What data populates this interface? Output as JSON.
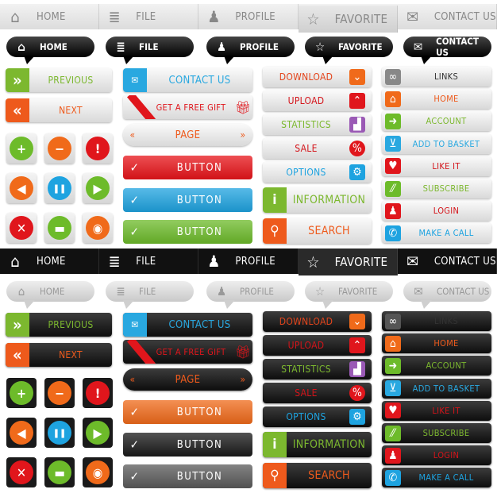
{
  "sections": [
    {
      "theme": "light",
      "nav": [
        {
          "label": "HOME",
          "icon": "home-icon",
          "glyph": "⌂"
        },
        {
          "label": "FILE",
          "icon": "file-icon",
          "glyph": "≣"
        },
        {
          "label": "PROFILE",
          "icon": "user-icon",
          "glyph": "♟"
        },
        {
          "label": "FAVORITE",
          "icon": "star-icon",
          "glyph": "☆",
          "active": true
        },
        {
          "label": "CONTACT US",
          "icon": "mail-icon",
          "glyph": "✉"
        }
      ],
      "bubbles": [
        {
          "label": "HOME",
          "icon": "home-icon",
          "glyph": "⌂"
        },
        {
          "label": "FILE",
          "icon": "file-icon",
          "glyph": "≣"
        },
        {
          "label": "PROFILE",
          "icon": "user-icon",
          "glyph": "♟"
        },
        {
          "label": "FAVORITE",
          "icon": "star-icon",
          "glyph": "☆"
        },
        {
          "label": "CONTACT US",
          "icon": "mail-icon",
          "glyph": "✉"
        }
      ],
      "previous": {
        "label": "PREVIOUS",
        "color": "#7cb82f",
        "glyph": "»"
      },
      "next": {
        "label": "NEXT",
        "color": "#ee5a1c",
        "glyph": "«"
      },
      "icon_grid": [
        {
          "icon": "plus-icon",
          "glyph": "+",
          "color": "#6dbb2a"
        },
        {
          "icon": "minus-icon",
          "glyph": "−",
          "color": "#f06a1a"
        },
        {
          "icon": "alert-icon",
          "glyph": "!",
          "color": "#e0161c"
        },
        {
          "icon": "back-icon",
          "glyph": "◀",
          "color": "#f06a1a"
        },
        {
          "icon": "pause-icon",
          "glyph": "❚❚",
          "color": "#1ea3e0"
        },
        {
          "icon": "play-icon",
          "glyph": "▶",
          "color": "#6dbb2a"
        },
        {
          "icon": "close-icon",
          "glyph": "✕",
          "color": "#e0161c"
        },
        {
          "icon": "chat-icon",
          "glyph": "▬",
          "color": "#6dbb2a"
        },
        {
          "icon": "rss-icon",
          "glyph": "◉",
          "color": "#f06a1a"
        }
      ],
      "contact": {
        "label": "CONTACT US",
        "color": "#29a8e0"
      },
      "gift": {
        "label": "GET A FREE GIFT",
        "color": "#e0161c"
      },
      "page": {
        "label": "PAGE",
        "color": "#ee5a1c"
      },
      "buttons": [
        {
          "label": "BUTTON",
          "color": "#e8141a"
        },
        {
          "label": "BUTTON",
          "color": "#1ea3e0"
        },
        {
          "label": "BUTTON",
          "color": "#6dbb2a"
        }
      ],
      "col3": [
        {
          "label": "DOWNLOAD",
          "color": "#e4451c",
          "icon": "download-icon",
          "glyph": "⌄",
          "icolor": "#f06a1a"
        },
        {
          "label": "UPLOAD",
          "color": "#d4141a",
          "icon": "upload-icon",
          "glyph": "⌃",
          "icolor": "#e0161c"
        },
        {
          "label": "STATISTICS",
          "color": "#7cb82f",
          "icon": "chart-icon",
          "glyph": "▟",
          "icolor": "#9a59b5"
        },
        {
          "label": "SALE",
          "color": "#d4141a",
          "icon": "percent-icon",
          "glyph": "%",
          "icolor": "#e0161c"
        },
        {
          "label": "OPTIONS",
          "color": "#1ea3e0",
          "icon": "gear-icon",
          "glyph": "⚙",
          "icolor": "#1ea3e0"
        }
      ],
      "information": {
        "label": "INFORMATION",
        "color": "#7cb82f",
        "glyph": "i"
      },
      "search": {
        "label": "SEARCH",
        "color": "#ee5a1c",
        "glyph": "⚲"
      },
      "col4": [
        {
          "label": "LINKS",
          "color": "#333333",
          "icon": "link-icon",
          "glyph": "∞",
          "icolor": "#888888"
        },
        {
          "label": "HOME",
          "color": "#ee5a1c",
          "icon": "home-icon",
          "glyph": "⌂",
          "icolor": "#f06a1a"
        },
        {
          "label": "ACCOUNT",
          "color": "#7cb82f",
          "icon": "arrow-right-icon",
          "glyph": "➜",
          "icolor": "#6dbb2a"
        },
        {
          "label": "ADD TO BASKET",
          "color": "#29a8e0",
          "icon": "cart-icon",
          "glyph": "⊻",
          "icolor": "#29a8e0"
        },
        {
          "label": "LIKE IT",
          "color": "#d4141a",
          "icon": "heart-icon",
          "glyph": "♥",
          "icolor": "#e0161c"
        },
        {
          "label": "SUBSCRIBE",
          "color": "#7cb82f",
          "icon": "stripes-icon",
          "glyph": "⁄⁄",
          "icolor": "#6dbb2a"
        },
        {
          "label": "LOGIN",
          "color": "#d4141a",
          "icon": "user-icon",
          "glyph": "♟",
          "icolor": "#e0161c"
        },
        {
          "label": "MAKE A CALL",
          "color": "#1ea3e0",
          "icon": "phone-icon",
          "glyph": "✆",
          "icolor": "#1ea3e0"
        }
      ]
    },
    {
      "theme": "dark",
      "nav": [
        {
          "label": "HOME",
          "icon": "home-icon",
          "glyph": "⌂"
        },
        {
          "label": "FILE",
          "icon": "file-icon",
          "glyph": "≣"
        },
        {
          "label": "PROFILE",
          "icon": "user-icon",
          "glyph": "♟"
        },
        {
          "label": "FAVORITE",
          "icon": "star-icon",
          "glyph": "☆",
          "active": true
        },
        {
          "label": "CONTACT US",
          "icon": "mail-icon",
          "glyph": "✉"
        }
      ],
      "bubbles": [
        {
          "label": "HOME",
          "icon": "home-icon",
          "glyph": "⌂"
        },
        {
          "label": "FILE",
          "icon": "file-icon",
          "glyph": "≣"
        },
        {
          "label": "PROFILE",
          "icon": "user-icon",
          "glyph": "♟"
        },
        {
          "label": "FAVORITE",
          "icon": "star-icon",
          "glyph": "☆"
        },
        {
          "label": "CONTACT US",
          "icon": "mail-icon",
          "glyph": "✉"
        }
      ],
      "previous": {
        "label": "PREVIOUS",
        "color": "#7cb82f",
        "glyph": "»"
      },
      "next": {
        "label": "NEXT",
        "color": "#ee5a1c",
        "glyph": "«"
      },
      "icon_grid": [
        {
          "icon": "plus-icon",
          "glyph": "+",
          "color": "#6dbb2a"
        },
        {
          "icon": "minus-icon",
          "glyph": "−",
          "color": "#f06a1a"
        },
        {
          "icon": "alert-icon",
          "glyph": "!",
          "color": "#e0161c"
        },
        {
          "icon": "back-icon",
          "glyph": "◀",
          "color": "#f06a1a"
        },
        {
          "icon": "pause-icon",
          "glyph": "❚❚",
          "color": "#1ea3e0"
        },
        {
          "icon": "play-icon",
          "glyph": "▶",
          "color": "#6dbb2a"
        },
        {
          "icon": "close-icon",
          "glyph": "✕",
          "color": "#e0161c"
        },
        {
          "icon": "chat-icon",
          "glyph": "▬",
          "color": "#6dbb2a"
        },
        {
          "icon": "rss-icon",
          "glyph": "◉",
          "color": "#f06a1a"
        }
      ],
      "contact": {
        "label": "CONTACT US",
        "color": "#29a8e0"
      },
      "gift": {
        "label": "GET A FREE GIFT",
        "color": "#e0161c"
      },
      "page": {
        "label": "PAGE",
        "color": "#ee5a1c"
      },
      "buttons": [
        {
          "label": "BUTTON",
          "color": "#f06a1a"
        },
        {
          "label": "BUTTON",
          "color": "#1a1a1a"
        },
        {
          "label": "BUTTON",
          "color": "#5a5a5a"
        }
      ],
      "col3": [
        {
          "label": "DOWNLOAD",
          "color": "#e4451c",
          "icon": "download-icon",
          "glyph": "⌄",
          "icolor": "#f06a1a"
        },
        {
          "label": "UPLOAD",
          "color": "#d4141a",
          "icon": "upload-icon",
          "glyph": "⌃",
          "icolor": "#e0161c"
        },
        {
          "label": "STATISTICS",
          "color": "#7cb82f",
          "icon": "chart-icon",
          "glyph": "▟",
          "icolor": "#9a59b5"
        },
        {
          "label": "SALE",
          "color": "#d4141a",
          "icon": "percent-icon",
          "glyph": "%",
          "icolor": "#e0161c"
        },
        {
          "label": "OPTIONS",
          "color": "#1ea3e0",
          "icon": "gear-icon",
          "glyph": "⚙",
          "icolor": "#1ea3e0"
        }
      ],
      "information": {
        "label": "INFORMATION",
        "color": "#7cb82f",
        "glyph": "i"
      },
      "search": {
        "label": "SEARCH",
        "color": "#ee5a1c",
        "glyph": "⚲"
      },
      "col4": [
        {
          "label": "LINKS",
          "color": "#333333",
          "icon": "link-icon",
          "glyph": "∞",
          "icolor": "#555555"
        },
        {
          "label": "HOME",
          "color": "#ee5a1c",
          "icon": "home-icon",
          "glyph": "⌂",
          "icolor": "#f06a1a"
        },
        {
          "label": "ACCOUNT",
          "color": "#7cb82f",
          "icon": "arrow-right-icon",
          "glyph": "➜",
          "icolor": "#6dbb2a"
        },
        {
          "label": "ADD TO BASKET",
          "color": "#29a8e0",
          "icon": "cart-icon",
          "glyph": "⊻",
          "icolor": "#29a8e0"
        },
        {
          "label": "LIKE IT",
          "color": "#d4141a",
          "icon": "heart-icon",
          "glyph": "♥",
          "icolor": "#e0161c"
        },
        {
          "label": "SUBSCRIBE",
          "color": "#7cb82f",
          "icon": "stripes-icon",
          "glyph": "⁄⁄",
          "icolor": "#6dbb2a"
        },
        {
          "label": "LOGIN",
          "color": "#d4141a",
          "icon": "user-icon",
          "glyph": "♟",
          "icolor": "#e0161c"
        },
        {
          "label": "MAKE A CALL",
          "color": "#1ea3e0",
          "icon": "phone-icon",
          "glyph": "✆",
          "icolor": "#1ea3e0"
        }
      ]
    }
  ]
}
